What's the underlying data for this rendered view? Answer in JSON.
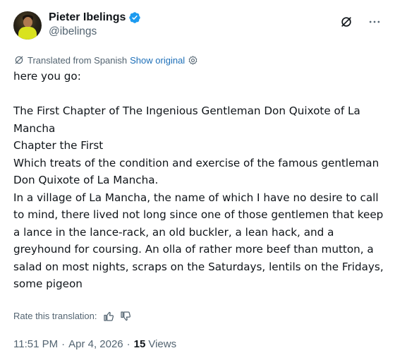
{
  "author": {
    "display_name": "Pieter Ibelings",
    "handle": "@ibelings",
    "verified_color": "#1d9bf0"
  },
  "header_actions": {
    "grok_icon": "slashed-circle-icon",
    "more_icon": "more-horizontal-icon"
  },
  "translation": {
    "label": "Translated from Spanish",
    "show_original": "Show original",
    "settings_icon": "gear-icon"
  },
  "body": {
    "intro": "here you go:",
    "title_line": "The First Chapter of The Ingenious Gentleman Don Quixote of La Mancha",
    "chapter_line": "Chapter the First",
    "subtitle_line": "Which treats of the condition and exercise of the famous gentleman Don Quixote of La Mancha.",
    "paragraph": "In a village of La Mancha, the name of which I have no desire to call to mind, there lived not long since one of those gentlemen that keep a lance in the lance-rack, an old buckler, a lean hack, and a greyhound for coursing. An olla of rather more beef than mutton, a salad on most nights, scraps on the Saturdays, lentils on the Fridays, some pigeon"
  },
  "rating": {
    "label": "Rate this translation:",
    "thumbs_up_icon": "thumbs-up-icon",
    "thumbs_down_icon": "thumbs-down-icon"
  },
  "meta": {
    "time": "11:51 PM",
    "separator": "·",
    "date": "Apr 4, 2026",
    "views_count": "15",
    "views_label": "Views"
  },
  "colors": {
    "text_primary": "#0f1419",
    "text_secondary": "#536471",
    "link": "#1d6fb8"
  }
}
